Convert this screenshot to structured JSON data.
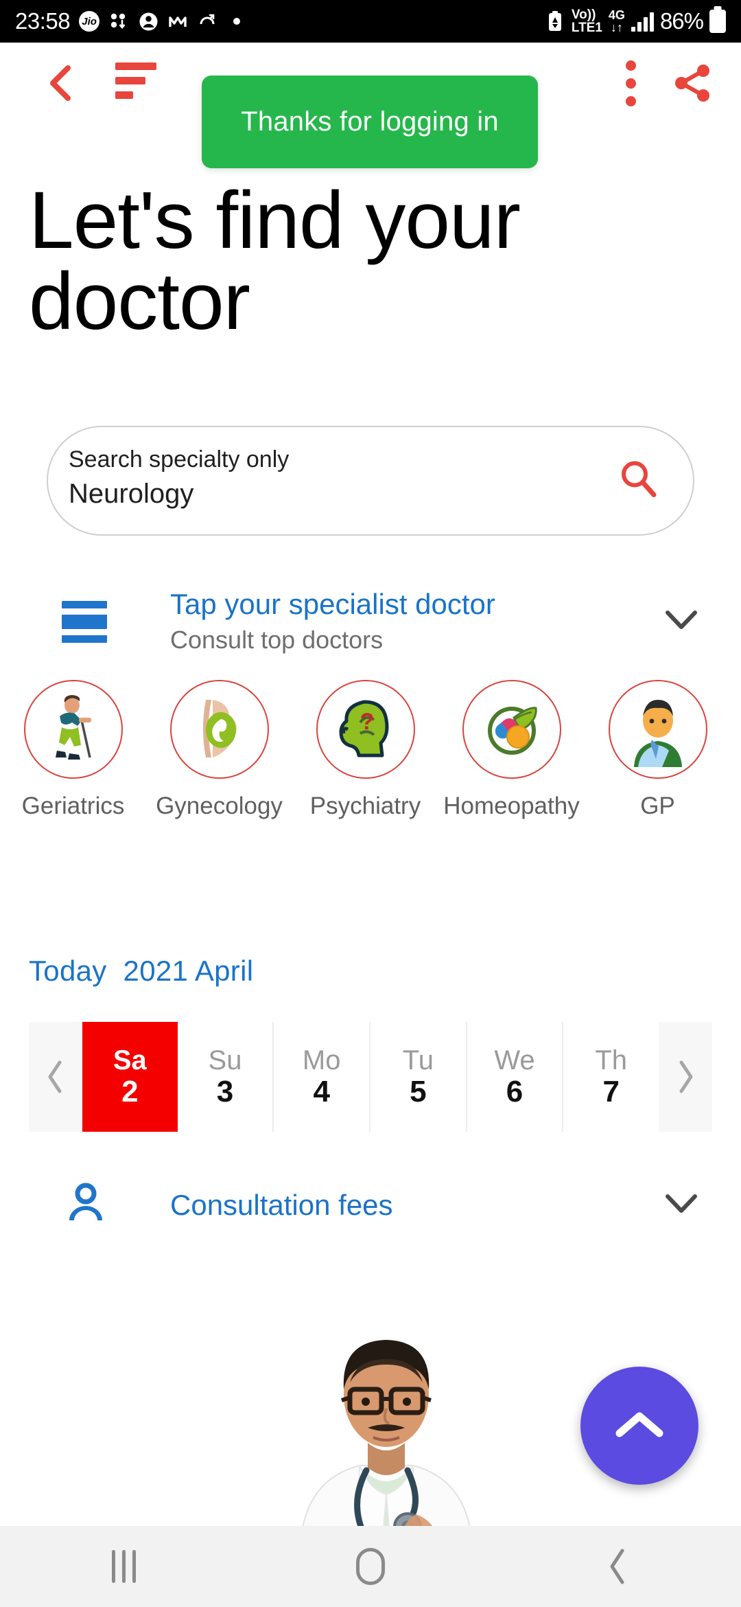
{
  "statusbar": {
    "clock": "23:58",
    "carrier_badge": "Jio",
    "volte_top": "Vo))",
    "volte_bottom": "LTE1",
    "network_top": "4G",
    "network_bottom": "↓↑",
    "battery_percent": "86%",
    "left_icons": [
      "jio-icon",
      "bluetooth-transfer-icon",
      "contact-icon",
      "m-app-icon",
      "screenshot-icon",
      "dot-icon"
    ],
    "right_icons": [
      "data-saver-icon",
      "volte-icon",
      "4g-icon",
      "signal-bars-icon",
      "battery-icon"
    ]
  },
  "appbar": {
    "back_label": "Back",
    "sort_label": "Sort",
    "more_label": "More options",
    "share_label": "Share",
    "accent_color": "#E8453C"
  },
  "toast": {
    "message": "Thanks for logging in",
    "background": "#25B74B",
    "text_color": "#FFFFFF"
  },
  "page": {
    "headline": "Let's find your doctor"
  },
  "search": {
    "hint": "Search specialty only",
    "value": "Neurology",
    "icon": "search-icon",
    "icon_color": "#E8453C"
  },
  "specialist_section": {
    "title": "Tap your specialist doctor",
    "subtitle": "Consult top doctors",
    "title_color": "#1A73C8",
    "chevron": "chevron-down-icon"
  },
  "specialties": [
    {
      "label": "Geriatrics",
      "icon": "elderly-person-walking-icon"
    },
    {
      "label": "Gynecology",
      "icon": "pregnant-belly-icon"
    },
    {
      "label": "Psychiatry",
      "icon": "head-question-mark-icon"
    },
    {
      "label": "Homeopathy",
      "icon": "herbal-pills-leaf-icon"
    },
    {
      "label": "GP",
      "icon": "doctor-avatar-icon"
    }
  ],
  "calendar": {
    "today_label": "Today",
    "month_label": "2021 April",
    "prev_icon": "chevron-left-icon",
    "next_icon": "chevron-right-icon",
    "selected_color": "#F40000",
    "days": [
      {
        "dow": "Sa",
        "num": "2",
        "selected": true
      },
      {
        "dow": "Su",
        "num": "3",
        "selected": false
      },
      {
        "dow": "Mo",
        "num": "4",
        "selected": false
      },
      {
        "dow": "Tu",
        "num": "5",
        "selected": false
      },
      {
        "dow": "We",
        "num": "6",
        "selected": false
      },
      {
        "dow": "Th",
        "num": "7",
        "selected": false
      }
    ]
  },
  "fees_section": {
    "title": "Consultation fees",
    "title_color": "#1A73C8",
    "icon": "person-icon",
    "chevron": "chevron-down-icon"
  },
  "doctor_card": {
    "image": "doctor-portrait-photo"
  },
  "fab": {
    "icon": "chevron-up-icon",
    "color": "#5B4BE0"
  },
  "navbar": {
    "recents_label": "Recents",
    "home_label": "Home",
    "back_label": "Back"
  }
}
